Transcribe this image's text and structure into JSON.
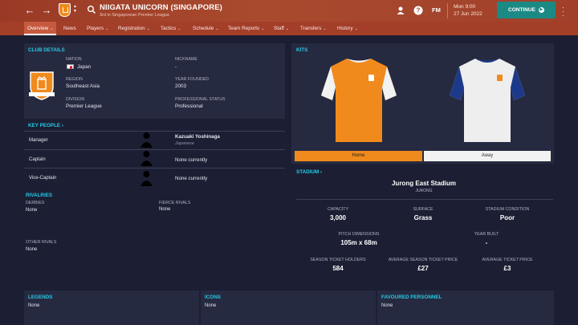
{
  "header": {
    "club_name": "NIIGATA UNICORN (SINGAPORE)",
    "club_subtitle": "3rd in Singaporean Premier League",
    "fm_logo": "FM",
    "day_time": "Mon 9:00",
    "date": "27 Jun 2022",
    "continue_label": "CONTINUE",
    "icons": [
      "back-arrow-icon",
      "forward-arrow-icon",
      "club-crest-icon",
      "search-icon",
      "manager-icon",
      "help-icon",
      "fm-logo-icon",
      "continue-icon",
      "more-icon"
    ]
  },
  "tabs": [
    {
      "label": "Overview",
      "dropdown": true,
      "active": true
    },
    {
      "label": "News",
      "dropdown": false
    },
    {
      "label": "Players",
      "dropdown": true
    },
    {
      "label": "Registration",
      "dropdown": true
    },
    {
      "label": "Tactics",
      "dropdown": true
    },
    {
      "label": "Schedule",
      "dropdown": true
    },
    {
      "label": "Team Reports",
      "dropdown": true
    },
    {
      "label": "Staff",
      "dropdown": true
    },
    {
      "label": "Transfers",
      "dropdown": true
    },
    {
      "label": "History",
      "dropdown": true
    }
  ],
  "club_details": {
    "title": "CLUB DETAILS",
    "nation_label": "NATION",
    "nation": "Japan",
    "nickname_label": "NICKNAME",
    "nickname": "-",
    "region_label": "REGION",
    "region": "Southeast Asia",
    "year_founded_label": "YEAR FOUNDED",
    "year_founded": "2003",
    "division_label": "DIVISION",
    "division": "Premier League",
    "status_label": "PROFESSIONAL STATUS",
    "status": "Professional"
  },
  "key_people": {
    "title": "KEY PEOPLE",
    "rows": [
      {
        "role": "Manager",
        "name": "Kazuaki Yoshinaga",
        "sub": "Japanese"
      },
      {
        "role": "Captain",
        "name": "None currently",
        "sub": ""
      },
      {
        "role": "Vice-Captain",
        "name": "None currently",
        "sub": ""
      }
    ]
  },
  "rivalries": {
    "title": "RIVALRIES",
    "derbies_label": "DERBIES",
    "derbies": "None",
    "fierce_label": "FIERCE RIVALS",
    "fierce": "None",
    "other_label": "OTHER RIVALS",
    "other": "None"
  },
  "kits": {
    "title": "KITS",
    "home_label": "Home",
    "away_label": "Away",
    "colors": {
      "home_body": "#f08a1c",
      "home_sleeve": "#f2f2f2",
      "away_body": "#eeeeee",
      "away_sleeve": "#1d3a8a"
    }
  },
  "stadium": {
    "title": "STADIUM",
    "name": "Jurong East Stadium",
    "location": "JURONG",
    "capacity_label": "CAPACITY",
    "capacity": "3,000",
    "surface_label": "SURFACE",
    "surface": "Grass",
    "condition_label": "STADIUM CONDITION",
    "condition": "Poor",
    "pitch_label": "PITCH DIMENSIONS",
    "pitch": "105m x 68m",
    "year_built_label": "YEAR BUILT",
    "year_built": "-",
    "season_holders_label": "SEASON TICKET HOLDERS",
    "season_holders": "584",
    "avg_season_price_label": "AVERAGE SEASON TICKET PRICE",
    "avg_season_price": "£27",
    "avg_ticket_label": "AVERAGE TICKET PRICE",
    "avg_ticket": "£3"
  },
  "bottom": {
    "legends_title": "LEGENDS",
    "legends": "None",
    "icons_title": "ICONS",
    "icons": "None",
    "favoured_title": "FAVOURED PERSONNEL",
    "favoured": "None"
  },
  "colors": {
    "accent": "#26c9e4",
    "header": "#a94a2e",
    "continue": "#1c8a84",
    "panel": "#262a40",
    "background": "#1c1f33"
  }
}
